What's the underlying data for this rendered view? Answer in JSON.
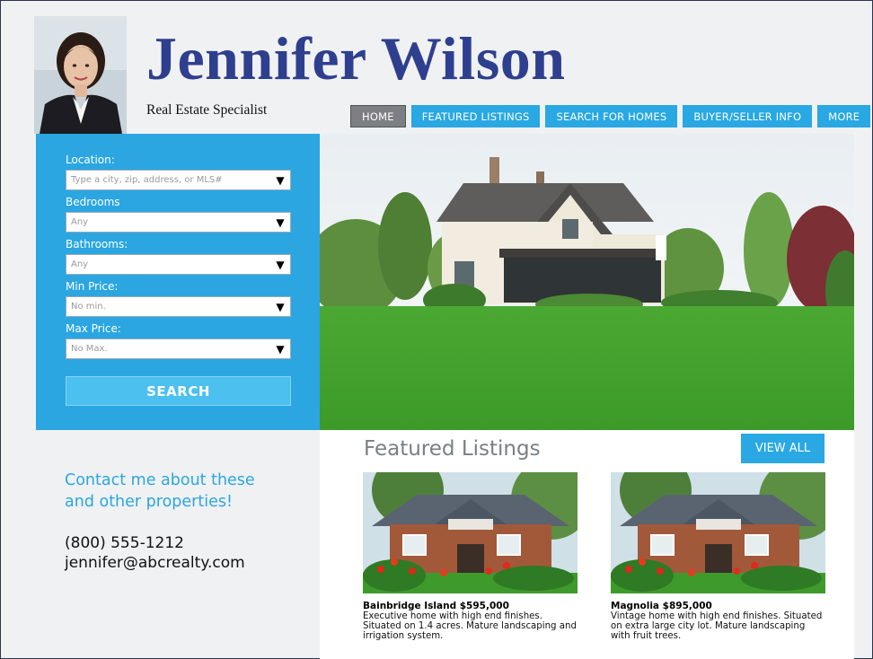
{
  "agent": {
    "name": "Jennifer Wilson",
    "tagline": "Real Estate Specialist"
  },
  "nav": [
    {
      "label": "HOME",
      "active": true
    },
    {
      "label": "FEATURED LISTINGS",
      "active": false
    },
    {
      "label": "SEARCH FOR HOMES",
      "active": false
    },
    {
      "label": "BUYER/SELLER INFO",
      "active": false
    },
    {
      "label": "MORE",
      "active": false
    }
  ],
  "search": {
    "fields": [
      {
        "label": "Location:",
        "value": "Type a city, zip, address, or MLS#"
      },
      {
        "label": "Bedrooms",
        "value": "Any"
      },
      {
        "label": "Bathrooms:",
        "value": "Any"
      },
      {
        "label": "Min Price:",
        "value": "No min."
      },
      {
        "label": "Max Price:",
        "value": "No Max."
      }
    ],
    "button_label": "SEARCH"
  },
  "contact": {
    "heading": "Contact me about these and other properties!",
    "phone": "(800) 555-1212",
    "email": "jennifer@abcrealty.com"
  },
  "featured": {
    "title": "Featured Listings",
    "view_all_label": "VIEW ALL",
    "listings": [
      {
        "title": "Bainbridge Island $595,000",
        "description": "Executive home with high end finishes. Situated on 1.4 acres. Mature landscaping and irrigation system."
      },
      {
        "title": "Magnolia $895,000",
        "description": "Vintage home with high end finishes. Situated on extra large city lot. Mature landscaping with fruit trees."
      }
    ]
  },
  "colors": {
    "brand_navy": "#2f3f8f",
    "accent_blue": "#2ba6e1",
    "nav_active_gray": "#7c8082",
    "lawn_green": "#3f9a2c"
  }
}
